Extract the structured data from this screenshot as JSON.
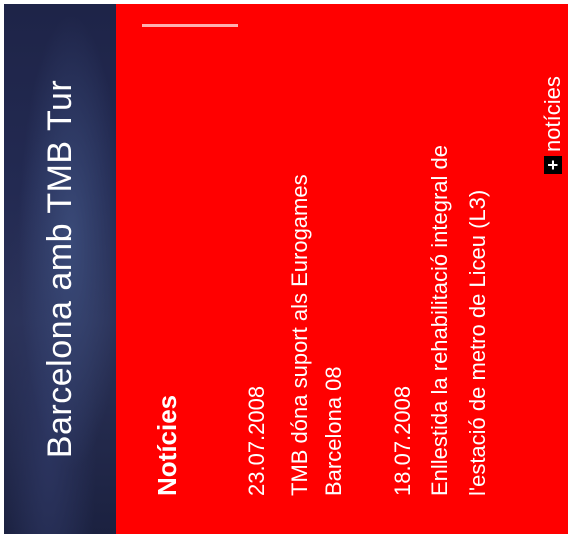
{
  "banner": {
    "title": "Barcelona amb TMB   Tur"
  },
  "news": {
    "heading": "Notícies",
    "items": [
      {
        "date": "23.07.2008",
        "lines": [
          "TMB dóna suport als Eurogames",
          "Barcelona 08"
        ]
      },
      {
        "date": "18.07.2008",
        "lines": [
          "Enllestida la rehabilitació integral de",
          "l'estació de metro de Liceu (L3)"
        ]
      }
    ],
    "more_label": "notícies",
    "more_icon": "plus-icon"
  },
  "colors": {
    "panel_red": "#ff0000",
    "banner_dark": "#1e2448",
    "text": "#ffffff"
  }
}
